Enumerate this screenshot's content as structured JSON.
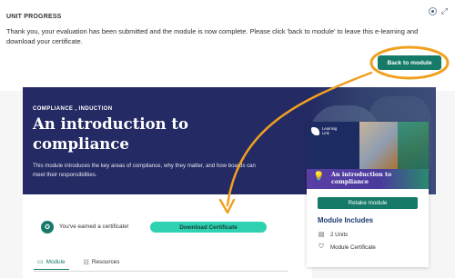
{
  "unit_progress": {
    "title": "UNIT PROGRESS",
    "message": "Thank you, your evaluation has been submitted and the module is now complete. Please click 'back to module' to leave this e-learning and download your certificate.",
    "back_button": "Back to module",
    "icons": [
      "target-icon",
      "expand-icon"
    ]
  },
  "hero": {
    "meta": "COMPLIANCE ,  INDUCTION",
    "title": "An introduction to compliance",
    "description": "This module introduces the key areas of compliance, why they matter, and how boards can meet their responsibilities."
  },
  "certificate": {
    "icon": "certificate-icon",
    "text": "You've earned a certificate!",
    "download_button": "Download Certificate"
  },
  "tabs": [
    {
      "label": "Module",
      "icon": "module-icon",
      "active": true
    },
    {
      "label": "Resources",
      "icon": "resources-icon",
      "active": false
    }
  ],
  "side_card": {
    "logo_text": "Learning Link",
    "thumb_title": "An introduction to compliance",
    "retake_button": "Retake module",
    "includes_title": "Module Includes",
    "includes": [
      {
        "icon": "units-icon",
        "text": "2 Units"
      },
      {
        "icon": "certificate-icon",
        "text": "Module Certificate"
      }
    ]
  },
  "colors": {
    "accent_green": "#167a68",
    "download_teal": "#2ed1b2",
    "hero_navy": "#242a63",
    "annotation_orange": "#f0a020"
  }
}
